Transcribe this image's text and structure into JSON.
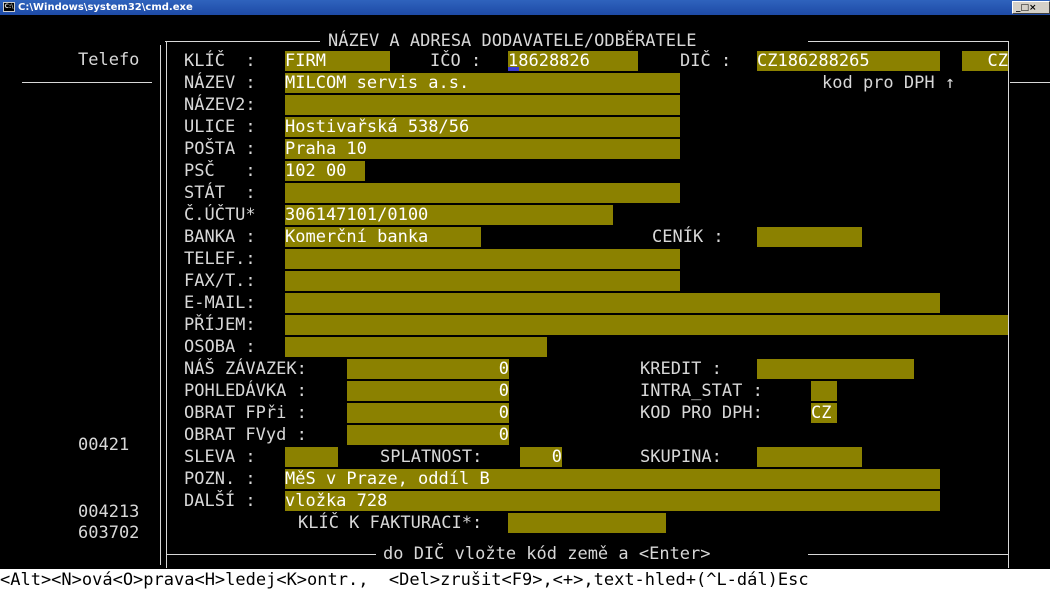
{
  "window": {
    "title": "C:\\Windows\\system32\\cmd.exe",
    "controls": "_□×"
  },
  "background": {
    "col_label": "Telefo",
    "rows": [
      "00421",
      "004213",
      "603702"
    ]
  },
  "dialog": {
    "title": "NÁZEV A ADRESA DODAVATELE/ODBĚRATELE",
    "footer_hint": "do DIČ vložte kód země a <Enter>",
    "klic": {
      "label": "KLÍČ  :",
      "value": "FIRM"
    },
    "ico": {
      "label": "IČO :",
      "value": "18628826"
    },
    "dic": {
      "label": "DIČ :",
      "value": "CZ186288265",
      "country": "CZ",
      "note": "kod pro DPH ↑"
    },
    "nazev": {
      "label": "NÁZEV :",
      "value": "MILCOM servis a.s."
    },
    "nazev2": {
      "label": "NÁZEV2:",
      "value": ""
    },
    "ulice": {
      "label": "ULICE :",
      "value": "Hostivařská 538/56"
    },
    "posta": {
      "label": "POŠTA :",
      "value": "Praha 10"
    },
    "psc": {
      "label": "PSČ   :",
      "value": "102 00"
    },
    "stat": {
      "label": "STÁT  :",
      "value": ""
    },
    "ucet": {
      "label": "Č.ÚČTU*",
      "value": "306147101/0100"
    },
    "banka": {
      "label": "BANKA :",
      "value": "Komerční banka"
    },
    "cenik": {
      "label": "CENÍK :",
      "value": ""
    },
    "telef": {
      "label": "TELEF.:",
      "value": ""
    },
    "fax": {
      "label": "FAX/T.:",
      "value": ""
    },
    "email": {
      "label": "E-MAIL:",
      "value": ""
    },
    "prijem": {
      "label": "PŘÍJEM:",
      "value": ""
    },
    "osoba": {
      "label": "OSOBA :",
      "value": ""
    },
    "zavazek": {
      "label": "NÁŠ ZÁVAZEK:",
      "value": "0"
    },
    "pohledavka": {
      "label": "POHLEDÁVKA :",
      "value": "0"
    },
    "obrat_fpri": {
      "label": "OBRAT FPři :",
      "value": "0"
    },
    "obrat_fvyd": {
      "label": "OBRAT FVyd :",
      "value": "0"
    },
    "kredit": {
      "label": "KREDIT :",
      "value": ""
    },
    "intra_stat": {
      "label": "INTRA_STAT :",
      "value": ""
    },
    "kod_dph": {
      "label": "KOD PRO DPH:",
      "value": "CZ"
    },
    "sleva": {
      "label": "SLEVA :",
      "value": ""
    },
    "splatnost": {
      "label": "SPLATNOST:",
      "value": "0"
    },
    "skupina": {
      "label": "SKUPINA:",
      "value": ""
    },
    "pozn": {
      "label": "POZN. :",
      "value": "MěS v Praze, oddíl B"
    },
    "dalsi": {
      "label": "DALŠÍ :",
      "value": "vložka 728"
    },
    "klic_fakturaci": {
      "label": "KLÍČ K FAKTURACI*:",
      "value": ""
    }
  },
  "statusbar": "<Alt><N>ová<O>prava<H>ledej<K>ontr.,  <Del>zrušit<F9>,<+>,text-hled+(^L-dál)Esc"
}
